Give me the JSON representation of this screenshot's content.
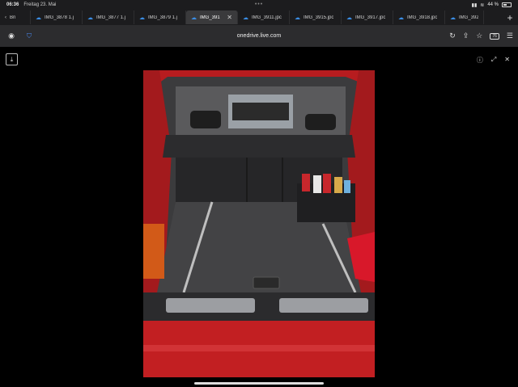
{
  "status": {
    "time": "06:36",
    "date": "Freitag 23. Mai",
    "battery": "44 %"
  },
  "tabs": [
    {
      "label": "Bn",
      "active": false
    },
    {
      "label": "IMG_3878 1.j",
      "active": false
    },
    {
      "label": "IMG_3877 1.j",
      "active": false
    },
    {
      "label": "IMG_3879 1.j",
      "active": false
    },
    {
      "label": "IMG_391",
      "active": true
    },
    {
      "label": "IMG_3911.jpc",
      "active": false
    },
    {
      "label": "IMG_3915.jpc",
      "active": false
    },
    {
      "label": "IMG_3917.jpc",
      "active": false
    },
    {
      "label": "IMG_3918.jpc",
      "active": false
    },
    {
      "label": "IMG_3920",
      "active": false
    }
  ],
  "urlbar": {
    "url": "onedrive.live.com",
    "tab_count": "76"
  },
  "icons": {
    "privacy": "incognito-icon",
    "shield": "shield-icon",
    "reload": "reload-icon",
    "share": "share-icon",
    "bookmark": "star-icon",
    "tabs": "tabs-icon",
    "menu": "menu-icon",
    "download": "download-icon",
    "info": "info-icon",
    "expand": "expand-icon",
    "close": "close-icon"
  },
  "photo": {
    "subject": "car trunk"
  },
  "colors": {
    "accent": "#3a8ee6",
    "car_red": "#c21f22"
  }
}
